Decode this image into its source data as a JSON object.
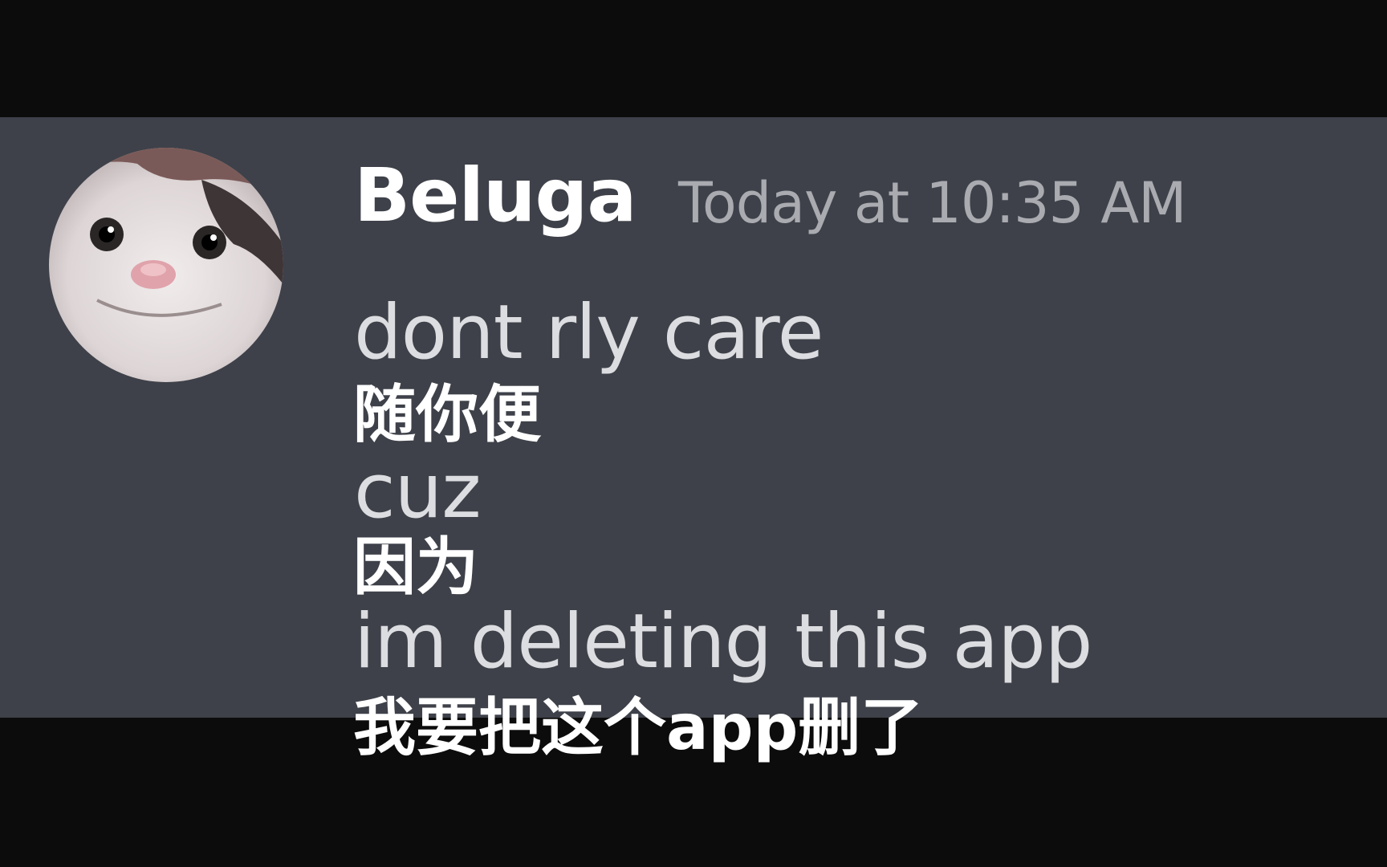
{
  "message": {
    "username": "Beluga",
    "timestamp": "Today at 10:35 AM",
    "lines": [
      "dont rly care",
      "cuz",
      "im deleting this app"
    ]
  },
  "subtitles": [
    "随你便",
    "因为",
    "我要把这个app删了"
  ],
  "colors": {
    "chat_background": "#3e4149",
    "letterbox": "#0c0c0c",
    "username": "#ffffff",
    "timestamp": "#a9abb1",
    "message_text": "#dcdde0",
    "subtitle_text": "#ffffff"
  },
  "icons": {
    "avatar": "beluga-cat-avatar"
  }
}
